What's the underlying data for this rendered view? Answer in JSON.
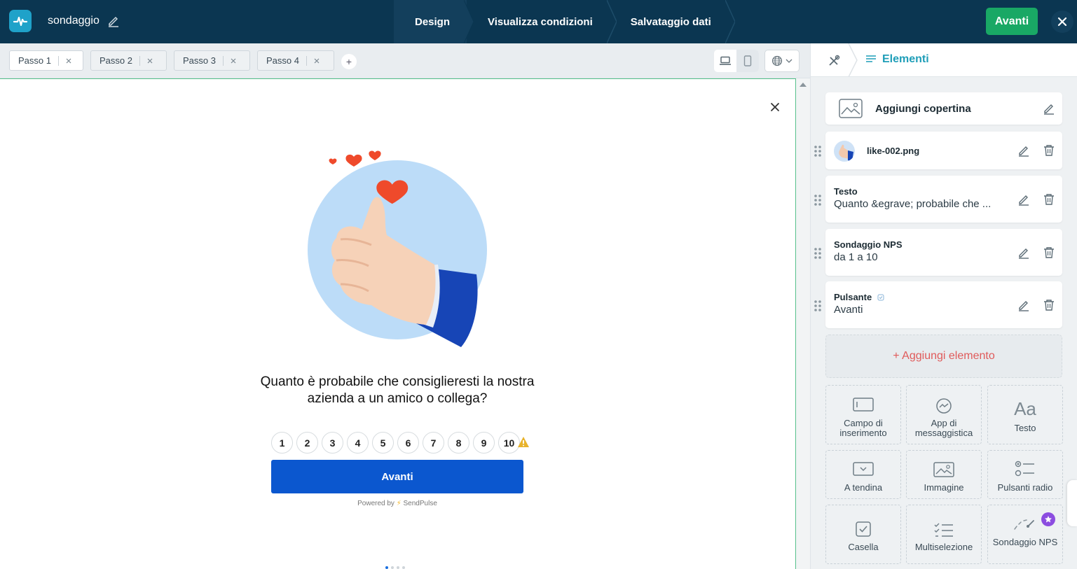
{
  "header": {
    "project_name": "sondaggio",
    "steps": [
      "Design",
      "Visualizza condizioni",
      "Salvataggio dati"
    ],
    "next_label": "Avanti"
  },
  "tabs": [
    "Passo 1",
    "Passo 2",
    "Passo 3",
    "Passo 4"
  ],
  "tab_add_label": "+",
  "popup": {
    "question": "Quanto è probabile che consiglieresti la nostra azienda a un amico o collega?",
    "nps_values": [
      "1",
      "2",
      "3",
      "4",
      "5",
      "6",
      "7",
      "8",
      "9",
      "10"
    ],
    "button_label": "Avanti",
    "powered_by": "Powered by",
    "brand": "SendPulse"
  },
  "panel": {
    "title": "Elementi",
    "cover_label": "Aggiungi copertina",
    "image_name": "like-002.png",
    "items": [
      {
        "title": "Testo",
        "subtitle": "Quanto &egrave; probabile che ..."
      },
      {
        "title": "Sondaggio NPS",
        "subtitle": "da 1 a 10"
      },
      {
        "title": "Pulsante",
        "subtitle": "Avanti"
      }
    ],
    "add_element_label": "+ Aggiungi elemento",
    "tiles": [
      {
        "label": "Campo di inserimento",
        "icon": "input-field-icon"
      },
      {
        "label": "App di messaggistica",
        "icon": "messenger-icon"
      },
      {
        "label": "Testo",
        "icon": "text-aa-icon"
      },
      {
        "label": "A tendina",
        "icon": "dropdown-icon"
      },
      {
        "label": "Immagine",
        "icon": "image-icon"
      },
      {
        "label": "Pulsanti radio",
        "icon": "radio-buttons-icon"
      },
      {
        "label": "Casella",
        "icon": "checkbox-icon"
      },
      {
        "label": "Multiselezione",
        "icon": "multiselect-icon"
      },
      {
        "label": "Sondaggio NPS",
        "icon": "nps-icon"
      }
    ],
    "text_icon_glyph": "Aa"
  },
  "colors": {
    "topbar": "#0b3651",
    "accent_green": "#19a865",
    "primary_blue": "#0b57cf",
    "panel_accent": "#1f9eb8",
    "add_element_red": "#e05a5a",
    "premium_purple": "#8c4de0"
  }
}
